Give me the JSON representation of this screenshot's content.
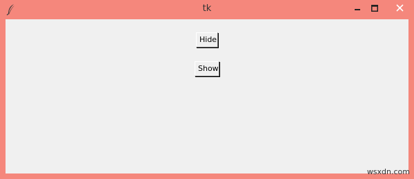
{
  "window": {
    "title": "tk",
    "app_icon": "feather-icon",
    "controls": {
      "minimize_icon": "minimize-icon",
      "maximize_icon": "maximize-icon",
      "close_icon": "close-icon"
    },
    "titlebar_color": "#f5877c",
    "client_color": "#f0f0f0"
  },
  "buttons": {
    "hide_label": "Hide",
    "show_label": "Show"
  },
  "watermark": "wsxdn.com"
}
